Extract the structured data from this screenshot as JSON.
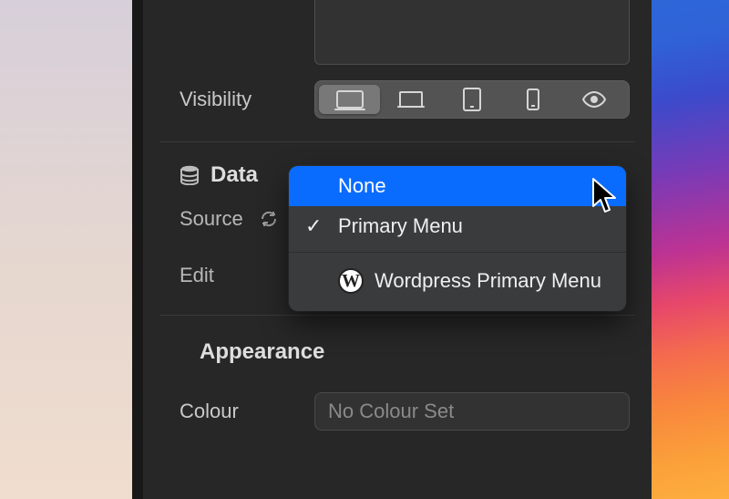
{
  "visibility": {
    "label": "Visibility"
  },
  "data_section": {
    "title": "Data",
    "source_label": "Source",
    "edit_label": "Edit"
  },
  "dropdown": {
    "items": [
      {
        "label": "None",
        "highlighted": true
      },
      {
        "label": "Primary Menu",
        "checked": true
      },
      {
        "label": "Wordpress Primary Menu",
        "wordpress": true
      }
    ]
  },
  "appearance_section": {
    "title": "Appearance",
    "colour_label": "Colour",
    "colour_value": "No Colour Set"
  }
}
